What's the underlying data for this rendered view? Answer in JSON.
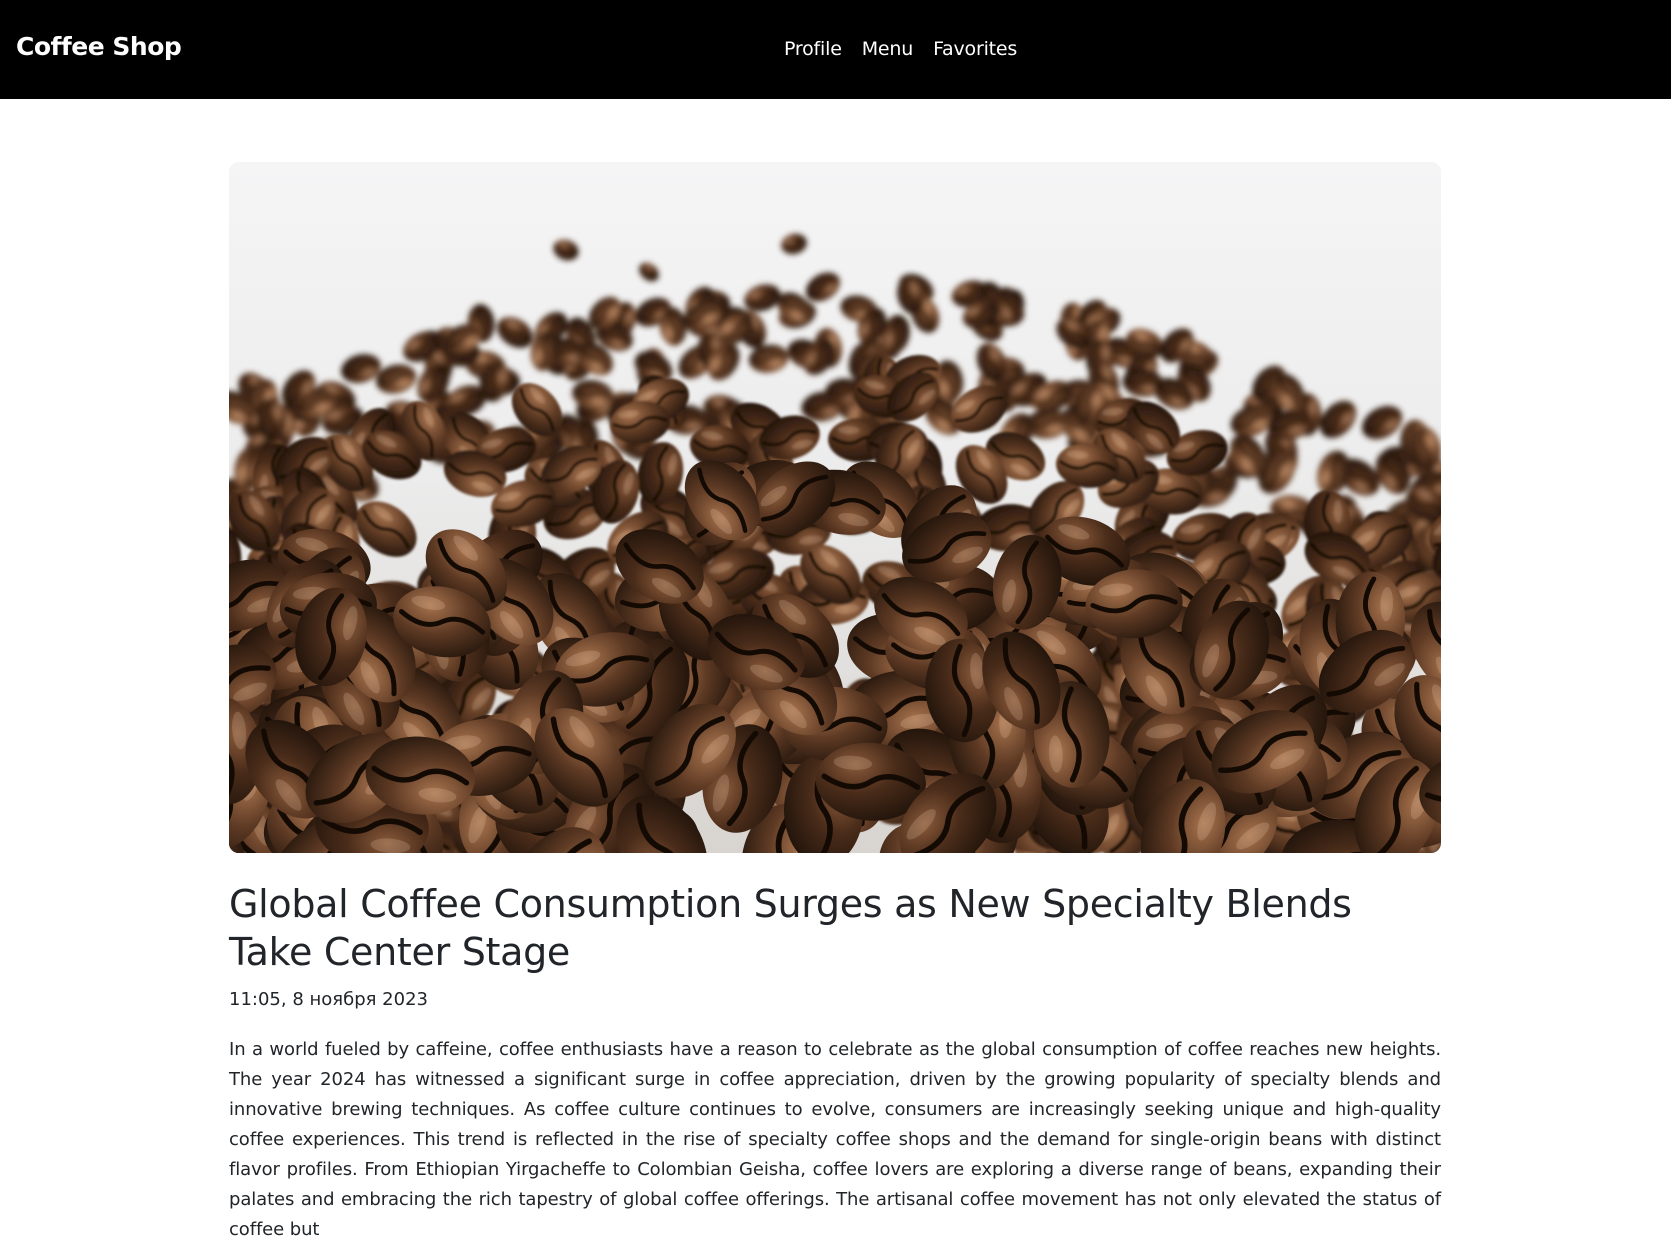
{
  "navbar": {
    "brand": "Coffee Shop",
    "links": [
      {
        "label": "Profile"
      },
      {
        "label": "Menu"
      },
      {
        "label": "Favorites"
      }
    ]
  },
  "article": {
    "image_alt": "coffee-beans-photo",
    "title": "Global Coffee Consumption Surges as New Specialty Blends Take Center Stage",
    "date": "11:05, 8 ноября 2023",
    "body": "In a world fueled by caffeine, coffee enthusiasts have a reason to celebrate as the global consumption of coffee reaches new heights. The year 2024 has witnessed a significant surge in coffee appreciation, driven by the growing popularity of specialty blends and innovative brewing techniques. As coffee culture continues to evolve, consumers are increasingly seeking unique and high-quality coffee experiences. This trend is reflected in the rise of specialty coffee shops and the demand for single-origin beans with distinct flavor profiles. From Ethiopian Yirgacheffe to Colombian Geisha, coffee lovers are exploring a diverse range of beans, expanding their palates and embracing the rich tapestry of global coffee offerings. The artisanal coffee movement has not only elevated the status of coffee but"
  },
  "colors": {
    "navbar_bg": "#000000",
    "nav_text": "#ffffff",
    "text": "#212529",
    "bean_dark": "#2a1a10",
    "bean_mid": "#4a2e1c",
    "bean_light": "#6b4530"
  }
}
